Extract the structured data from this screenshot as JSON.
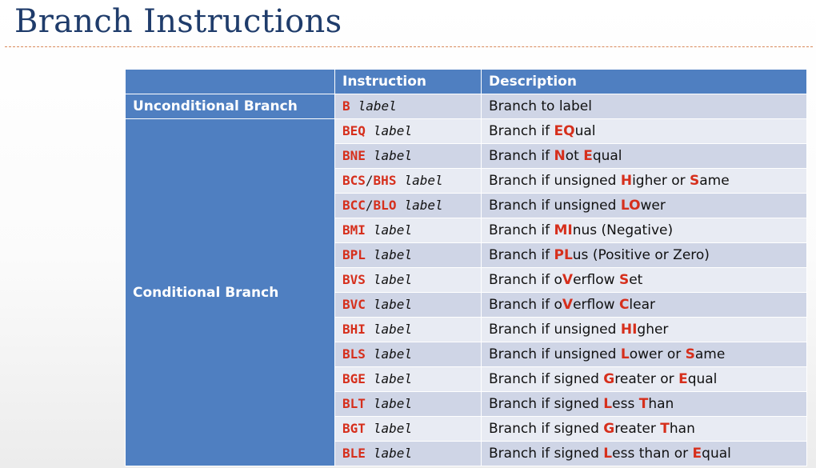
{
  "title": "Branch Instructions",
  "colors": {
    "header": "#4f7fc1",
    "highlight": "#d62f1c",
    "title": "#1f3c6b",
    "row_dark": "#cfd5e6",
    "row_light": "#e8ebf3"
  },
  "table": {
    "headers": [
      "",
      "Instruction",
      "Description"
    ],
    "groups": [
      {
        "label": "Unconditional Branch",
        "rows": [
          {
            "mnemonic": [
              "B"
            ],
            "operand": "label",
            "description": [
              [
                "Branch to label",
                false
              ]
            ]
          }
        ]
      },
      {
        "label": "Conditional Branch",
        "rows": [
          {
            "mnemonic": [
              "BEQ"
            ],
            "operand": "label",
            "description": [
              [
                "Branch if ",
                false
              ],
              [
                "EQ",
                true
              ],
              [
                "ual",
                false
              ]
            ]
          },
          {
            "mnemonic": [
              "BNE"
            ],
            "operand": "label",
            "description": [
              [
                "Branch if ",
                false
              ],
              [
                "N",
                true
              ],
              [
                "ot ",
                false
              ],
              [
                "E",
                true
              ],
              [
                "qual",
                false
              ]
            ]
          },
          {
            "mnemonic": [
              "BCS",
              "BHS"
            ],
            "operand": "label",
            "description": [
              [
                "Branch if unsigned ",
                false
              ],
              [
                "H",
                true
              ],
              [
                "igher or ",
                false
              ],
              [
                "S",
                true
              ],
              [
                "ame",
                false
              ]
            ]
          },
          {
            "mnemonic": [
              "BCC",
              "BLO"
            ],
            "operand": "label",
            "description": [
              [
                "Branch if unsigned ",
                false
              ],
              [
                "LO",
                true
              ],
              [
                "wer",
                false
              ]
            ]
          },
          {
            "mnemonic": [
              "BMI"
            ],
            "operand": "label",
            "description": [
              [
                "Branch if ",
                false
              ],
              [
                "MI",
                true
              ],
              [
                "nus (Negative)",
                false
              ]
            ]
          },
          {
            "mnemonic": [
              "BPL"
            ],
            "operand": "label",
            "description": [
              [
                "Branch if ",
                false
              ],
              [
                "PL",
                true
              ],
              [
                "us (Positive or Zero)",
                false
              ]
            ]
          },
          {
            "mnemonic": [
              "BVS"
            ],
            "operand": "label",
            "description": [
              [
                "Branch if o",
                false
              ],
              [
                "V",
                true
              ],
              [
                "erflow ",
                false
              ],
              [
                "S",
                true
              ],
              [
                "et",
                false
              ]
            ]
          },
          {
            "mnemonic": [
              "BVC"
            ],
            "operand": "label",
            "description": [
              [
                "Branch if o",
                false
              ],
              [
                "V",
                true
              ],
              [
                "erflow ",
                false
              ],
              [
                "C",
                true
              ],
              [
                "lear",
                false
              ]
            ]
          },
          {
            "mnemonic": [
              "BHI"
            ],
            "operand": "label",
            "description": [
              [
                "Branch if unsigned ",
                false
              ],
              [
                "HI",
                true
              ],
              [
                "gher",
                false
              ]
            ]
          },
          {
            "mnemonic": [
              "BLS"
            ],
            "operand": "label",
            "description": [
              [
                "Branch if unsigned ",
                false
              ],
              [
                "L",
                true
              ],
              [
                "ower or ",
                false
              ],
              [
                "S",
                true
              ],
              [
                "ame",
                false
              ]
            ]
          },
          {
            "mnemonic": [
              "BGE"
            ],
            "operand": "label",
            "description": [
              [
                "Branch if signed ",
                false
              ],
              [
                "G",
                true
              ],
              [
                "reater or ",
                false
              ],
              [
                "E",
                true
              ],
              [
                "qual",
                false
              ]
            ]
          },
          {
            "mnemonic": [
              "BLT"
            ],
            "operand": "label",
            "description": [
              [
                "Branch if signed ",
                false
              ],
              [
                "L",
                true
              ],
              [
                "ess ",
                false
              ],
              [
                "T",
                true
              ],
              [
                "han",
                false
              ]
            ]
          },
          {
            "mnemonic": [
              "BGT"
            ],
            "operand": "label",
            "description": [
              [
                "Branch if signed ",
                false
              ],
              [
                "G",
                true
              ],
              [
                "reater ",
                false
              ],
              [
                "T",
                true
              ],
              [
                "han",
                false
              ]
            ]
          },
          {
            "mnemonic": [
              "BLE"
            ],
            "operand": "label",
            "description": [
              [
                "Branch if signed ",
                false
              ],
              [
                "L",
                true
              ],
              [
                "ess than or ",
                false
              ],
              [
                "E",
                true
              ],
              [
                "qual",
                false
              ]
            ]
          }
        ]
      }
    ]
  }
}
